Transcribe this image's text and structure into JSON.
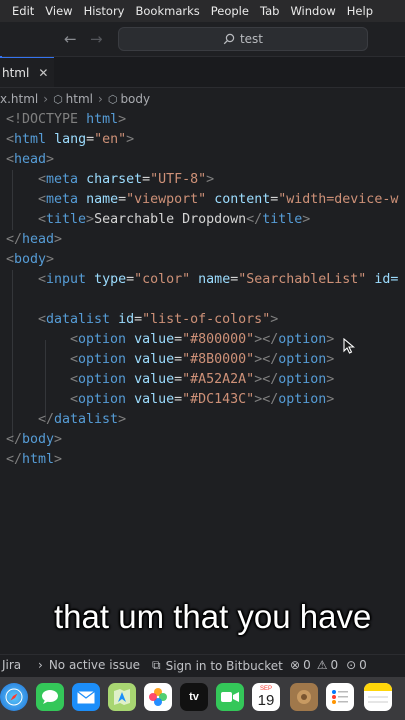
{
  "menubar": {
    "items": [
      "Edit",
      "View",
      "History",
      "Bookmarks",
      "People",
      "Tab",
      "Window",
      "Help"
    ]
  },
  "titlebar": {
    "search_text": "test"
  },
  "tab": {
    "label": "html",
    "close": "✕"
  },
  "breadcrumb": {
    "file": "x.html",
    "items": [
      "html",
      "body"
    ]
  },
  "code": {
    "l1": {
      "open": "<!DOCTYPE",
      "word": " html",
      "close": ">"
    },
    "l2": {
      "tag": "html",
      "attr": "lang",
      "val": "\"en\""
    },
    "l3": {
      "tag": "head"
    },
    "l4": {
      "tag": "meta",
      "attr": "charset",
      "val": "\"UTF-8\""
    },
    "l5": {
      "tag": "meta",
      "attr1": "name",
      "val1": "\"viewport\"",
      "attr2": "content",
      "val2": "\"width=device-w"
    },
    "l6": {
      "tag": "title",
      "text": "Searchable Dropdown"
    },
    "l7": {
      "tag": "head"
    },
    "l8": {
      "tag": "body"
    },
    "l9": {
      "tag": "input",
      "attr1": "type",
      "val1": "\"color\"",
      "attr2": "name",
      "val2": "\"SearchableList\"",
      "attr3": "id="
    },
    "l11": {
      "tag": "datalist",
      "attr": "id",
      "val": "\"list-of-colors\""
    },
    "options": [
      {
        "tag": "option",
        "attr": "value",
        "val": "\"#800000\""
      },
      {
        "tag": "option",
        "attr": "value",
        "val": "\"#8B0000\""
      },
      {
        "tag": "option",
        "attr": "value",
        "val": "\"#A52A2A\""
      },
      {
        "tag": "option",
        "attr": "value",
        "val": "\"#DC143C\""
      }
    ],
    "l16": {
      "tag": "datalist"
    },
    "l17": {
      "tag": "body"
    },
    "l18": {
      "tag": "html"
    }
  },
  "caption": "that um that you have",
  "statusbar": {
    "jira": "Jira",
    "issue": "No active issue",
    "bitbucket": "Sign in to Bitbucket",
    "errors": "0",
    "warnings": "0",
    "other": "0"
  },
  "dock": {
    "apps": [
      "safari-icon",
      "messages-icon",
      "mail-icon",
      "maps-icon",
      "photos-icon",
      "apple-tv-icon",
      "facetime-icon",
      "calendar-icon",
      "archive-icon",
      "reminders-icon",
      "notes-icon"
    ],
    "calendar_month": "SEP",
    "calendar_day": "19",
    "tv_label": "tv"
  }
}
